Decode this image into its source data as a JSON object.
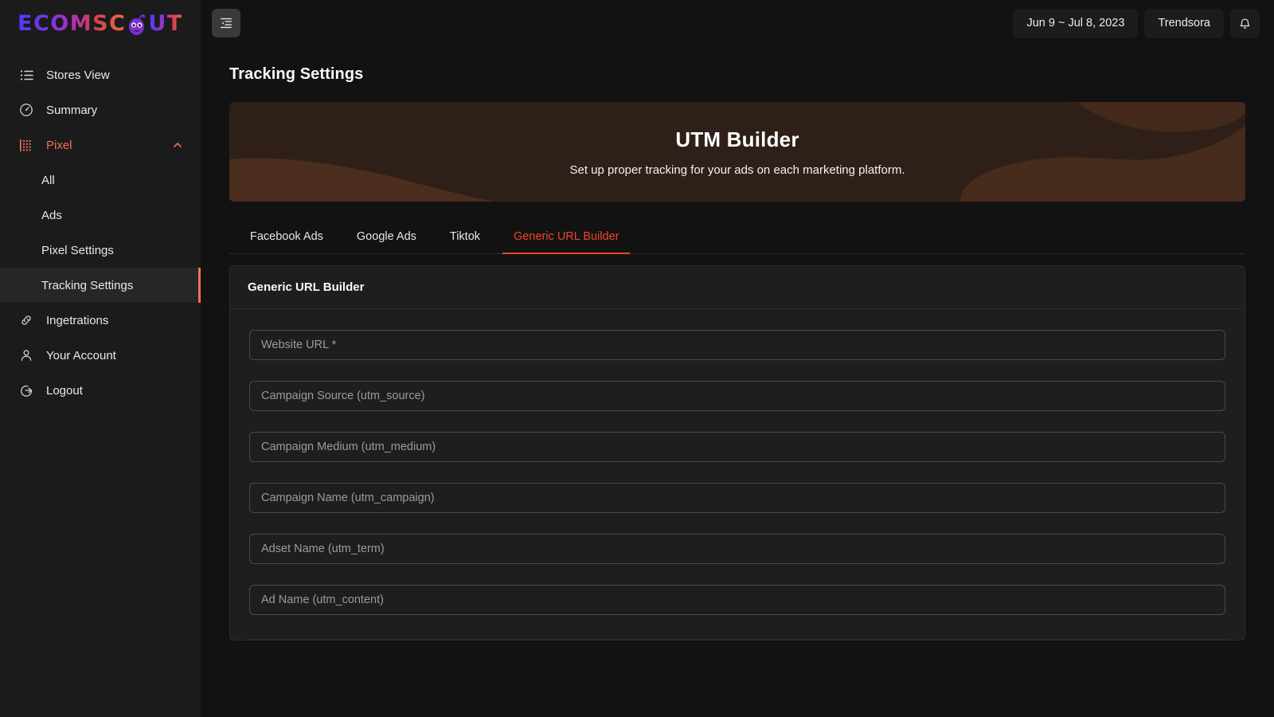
{
  "brand": {
    "text_left": "ECOMSC",
    "text_right": "UT",
    "icon": "alien-head-icon",
    "colors": {
      "start": "#4b3df5",
      "end": "#f0674a",
      "alien": "#7b2fd4"
    }
  },
  "sidebar": {
    "items": [
      {
        "label": "Stores View",
        "icon": "list-icon",
        "type": "item"
      },
      {
        "label": "Summary",
        "icon": "gauge-icon",
        "type": "item"
      },
      {
        "label": "Pixel",
        "icon": "grid-dots-icon",
        "type": "group",
        "expanded": true,
        "chevron": "chevron-up-icon"
      },
      {
        "label": "All",
        "type": "sub"
      },
      {
        "label": "Ads",
        "type": "sub"
      },
      {
        "label": "Pixel Settings",
        "type": "sub"
      },
      {
        "label": "Tracking Settings",
        "type": "sub",
        "active": true
      },
      {
        "label": "Ingetrations",
        "icon": "link-icon",
        "type": "item"
      },
      {
        "label": "Your Account",
        "icon": "user-icon",
        "type": "item"
      },
      {
        "label": "Logout",
        "icon": "logout-icon",
        "type": "item"
      }
    ],
    "accent_color": "#f2705b"
  },
  "topbar": {
    "collapse_icon": "sidebar-collapse-icon",
    "date_range": "Jun 9 ~ Jul 8, 2023",
    "store_name": "Trendsora",
    "notification_icon": "bell-icon"
  },
  "page": {
    "title": "Tracking Settings"
  },
  "banner": {
    "title": "UTM Builder",
    "subtitle": "Set up proper tracking for your ads on each marketing platform.",
    "bg_color": "#2e2018",
    "wave_color": "#4a2d1d"
  },
  "tabs": [
    {
      "label": "Facebook Ads",
      "active": false
    },
    {
      "label": "Google Ads",
      "active": false
    },
    {
      "label": "Tiktok",
      "active": false
    },
    {
      "label": "Generic URL Builder",
      "active": true
    }
  ],
  "tabs_accent": "#f4442e",
  "card": {
    "title": "Generic URL Builder",
    "fields": [
      {
        "placeholder": "Website URL *",
        "value": "",
        "name": "website-url-input"
      },
      {
        "placeholder": "Campaign Source (utm_source)",
        "value": "",
        "name": "campaign-source-input"
      },
      {
        "placeholder": "Campaign Medium (utm_medium)",
        "value": "",
        "name": "campaign-medium-input"
      },
      {
        "placeholder": "Campaign Name (utm_campaign)",
        "value": "",
        "name": "campaign-name-input"
      },
      {
        "placeholder": "Adset Name (utm_term)",
        "value": "",
        "name": "adset-name-input"
      },
      {
        "placeholder": "Ad Name (utm_content)",
        "value": "",
        "name": "ad-name-input"
      }
    ]
  }
}
